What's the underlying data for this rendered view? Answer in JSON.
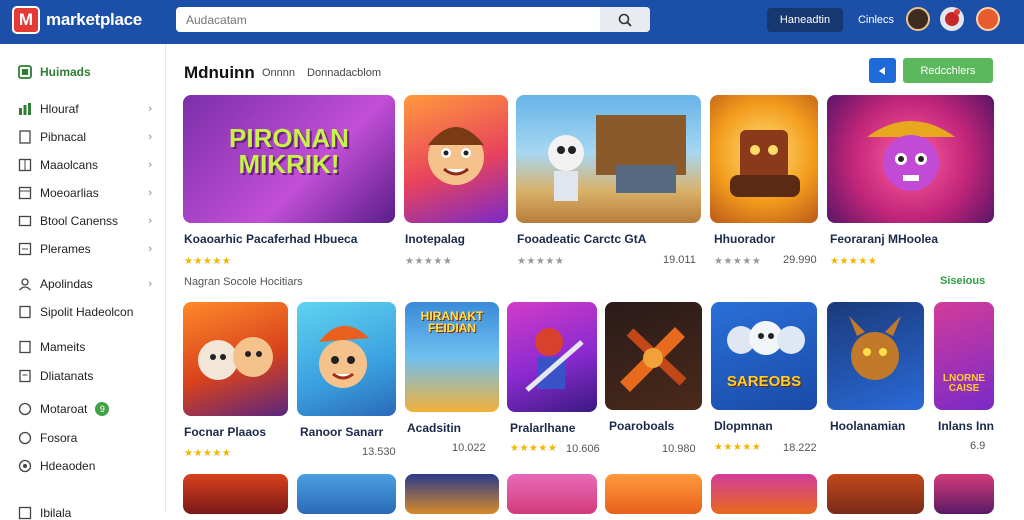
{
  "header": {
    "brand": "marketplace",
    "search_placeholder": "Audacatam",
    "btn_primary": "Haneadtin",
    "btn_secondary": "Cinlecs"
  },
  "sidebar": {
    "title": "Huimads",
    "items": [
      {
        "label": "Hlouraf",
        "chevron": true
      },
      {
        "label": "Pibnacal",
        "chevron": true
      },
      {
        "label": "Maaolcans",
        "chevron": true
      },
      {
        "label": "Moeoarlias",
        "chevron": true
      },
      {
        "label": "Btool Canenss",
        "chevron": true
      },
      {
        "label": "Plerames",
        "chevron": true
      },
      {
        "label": "Apolindas",
        "chevron": true
      },
      {
        "label": "Sipolit Hadeolcon",
        "chevron": false
      },
      {
        "label": "Mameits",
        "chevron": false
      },
      {
        "label": "Dliatanats",
        "chevron": false
      },
      {
        "label": "Motaroat",
        "chevron": false,
        "badge": "9"
      },
      {
        "label": "Fosora",
        "chevron": false
      },
      {
        "label": "Hdeaoden",
        "chevron": false
      },
      {
        "label": "Ibilala",
        "chevron": false
      }
    ]
  },
  "main": {
    "title": "Mdnuinn",
    "crumbs": [
      "Onnnn",
      "Donnadacblom"
    ],
    "action_button": "Redcchlers",
    "section_label": "Nagran Socole Hocitiars",
    "see_all": "Siseious"
  },
  "row1": [
    {
      "name": "Koaoarhic Pacaferhad Hbueca",
      "art": "PIRONAN MIKRIK!",
      "price": "",
      "stars": "★★★★★",
      "rated": true
    },
    {
      "name": "Inotepalag",
      "art": "",
      "price": "",
      "stars": "★★★★★",
      "rated": false
    },
    {
      "name": "Fooadeatic Carctc GtA",
      "art": "",
      "price": "19.011",
      "stars": "★★★★★",
      "rated": false
    },
    {
      "name": "Hhuorador",
      "art": "",
      "price": "29.990",
      "stars": "★★★★★",
      "rated": false
    },
    {
      "name": "Feoraranj MHoolea",
      "art": "",
      "price": "",
      "stars": "★★★★★",
      "rated": true
    }
  ],
  "row2": [
    {
      "name": "Focnar Plaaos",
      "art": "",
      "price": "",
      "stars": "★★★★★",
      "rated": true
    },
    {
      "name": "Ranoor Sanarr",
      "art": "",
      "price": "13.530",
      "stars": "",
      "rated": false
    },
    {
      "name": "Acadsitin",
      "art": "HIRANAKT FEIDIAN",
      "price": "10.022",
      "stars": "",
      "rated": false
    },
    {
      "name": "Pralarlhane",
      "art": "",
      "price": "10.606",
      "stars": "★★★★★",
      "rated": true
    },
    {
      "name": "Poaroboals",
      "art": "",
      "price": "10.980",
      "stars": "",
      "rated": false
    },
    {
      "name": "Dlopmnan",
      "art": "SAREOBS",
      "price": "18.222",
      "stars": "★★★★★",
      "rated": false
    },
    {
      "name": "Hoolanamian",
      "art": "",
      "price": "",
      "stars": "",
      "rated": false
    },
    {
      "name": "Inlans Inn",
      "art": "LNORNE CAISE",
      "price": "6.9",
      "stars": "",
      "rated": false
    }
  ],
  "colors": {
    "topbar": "#1c4fa8",
    "accent_green": "#5cb85c",
    "accent_blue": "#1e6ad8",
    "star": "#f4b400"
  }
}
